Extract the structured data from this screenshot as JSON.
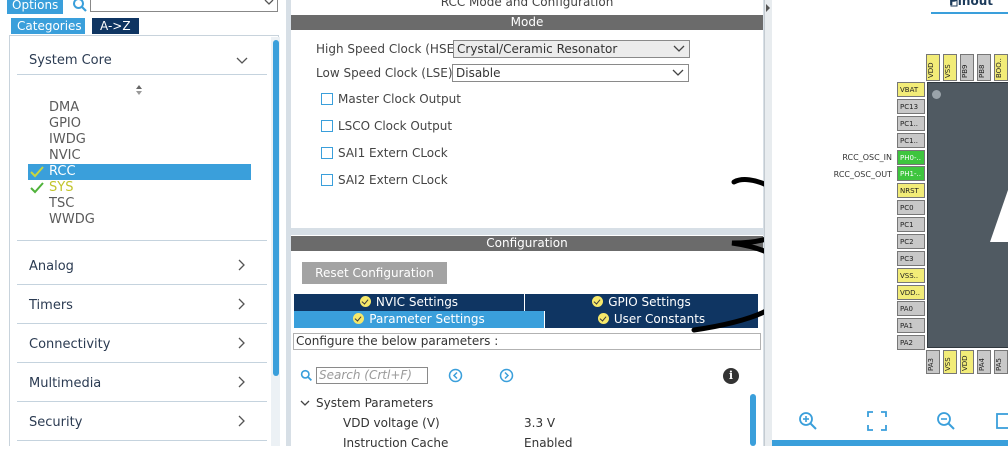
{
  "left": {
    "options_label": "Options",
    "tabs": {
      "categories": "Categories",
      "az": "A->Z"
    },
    "system_core": {
      "label": "System Core",
      "items": [
        "DMA",
        "GPIO",
        "IWDG",
        "NVIC",
        "RCC",
        "SYS",
        "TSC",
        "WWDG"
      ]
    },
    "categories": [
      "Analog",
      "Timers",
      "Connectivity",
      "Multimedia",
      "Security"
    ]
  },
  "mode": {
    "title": "RCC Mode and Configuration",
    "section": "Mode",
    "hse_label": "High Speed Clock (HSE)",
    "hse_value": "Crystal/Ceramic Resonator",
    "lse_label": "Low Speed Clock (LSE)",
    "lse_value": "Disable",
    "checkboxes": [
      "Master Clock Output",
      "LSCO Clock Output",
      "SAI1 Extern CLock",
      "SAI2 Extern CLock"
    ]
  },
  "config": {
    "section": "Configuration",
    "reset_label": "Reset Configuration",
    "tabs": [
      "NVIC Settings",
      "GPIO Settings",
      "Parameter Settings",
      "User Constants"
    ],
    "hint": "Configure the below parameters :",
    "search_placeholder": "Search (Crtl+F)",
    "group": "System Parameters",
    "params": [
      {
        "name": "VDD voltage (V)",
        "value": "3.3 V"
      },
      {
        "name": "Instruction Cache",
        "value": "Enabled"
      }
    ]
  },
  "pinout": {
    "tab_label": "Pinout",
    "left_pins": [
      "VBAT",
      "PC13",
      "PC1..",
      "PC1..",
      "PH0-..",
      "PH1-..",
      "NRST",
      "PC0",
      "PC1",
      "PC2",
      "PC3",
      "VSS..",
      "VDD..",
      "PA0",
      "PA1",
      "PA2"
    ],
    "signals": {
      "osc_in": "RCC_OSC_IN",
      "osc_out": "RCC_OSC_OUT"
    },
    "top_pins": [
      "VDD",
      "VSS",
      "PB9",
      "PB8",
      "BOO.."
    ],
    "bottom_pins": [
      "PA3",
      "VSS",
      "VDD",
      "PA4",
      "PA5",
      "PA6"
    ]
  },
  "colors": {
    "accent": "#3a9fdb",
    "navy": "#0f3562",
    "bar": "#6b6b6b",
    "pin_yellow": "#f2ec78",
    "pin_green": "#3ec53e"
  }
}
